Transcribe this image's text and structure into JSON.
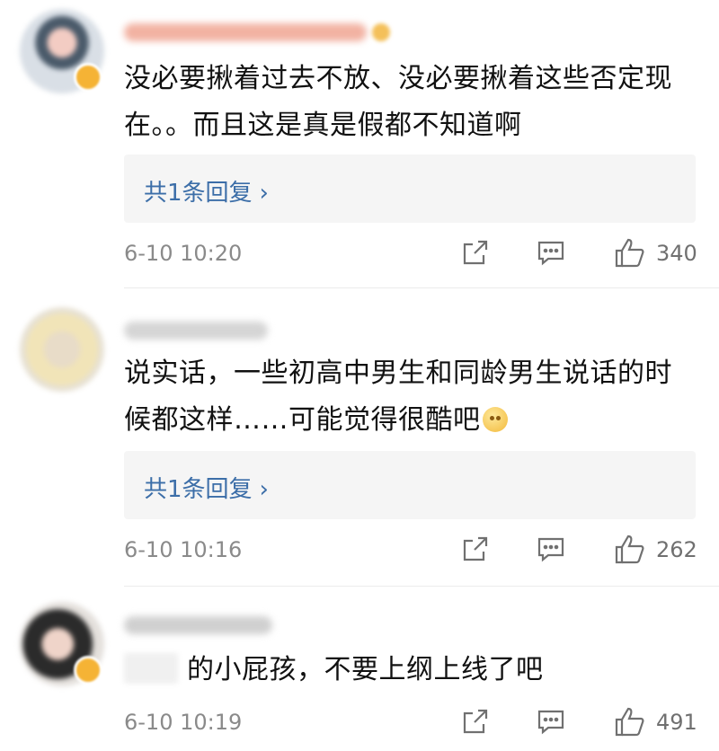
{
  "comments": [
    {
      "text": "没必要揪着过去不放、没必要揪着这些否定现在。。而且这是真是假都不知道啊",
      "reply_label": "共1条回复",
      "reply_chevron": "›",
      "time": "6-10 10:20",
      "likes": "340"
    },
    {
      "text": "说实话，一些初高中男生和同龄男生说话的时候都这样……可能觉得很酷吧",
      "reply_label": "共1条回复",
      "reply_chevron": "›",
      "time": "6-10 10:16",
      "likes": "262"
    },
    {
      "text": "的小屁孩，不要上纲上线了吧",
      "time": "6-10 10:19",
      "likes": "491"
    }
  ],
  "icons": {
    "share": "share-icon",
    "comment": "comment-icon",
    "like": "thumbs-up-icon",
    "emoji": "smiley-emoji-icon",
    "verified": "verified-badge-icon"
  },
  "colors": {
    "reply_link": "#3c6ea8",
    "meta_text": "#8a8a8a",
    "reply_bg": "#f5f5f5",
    "badge": "#f5b335"
  }
}
